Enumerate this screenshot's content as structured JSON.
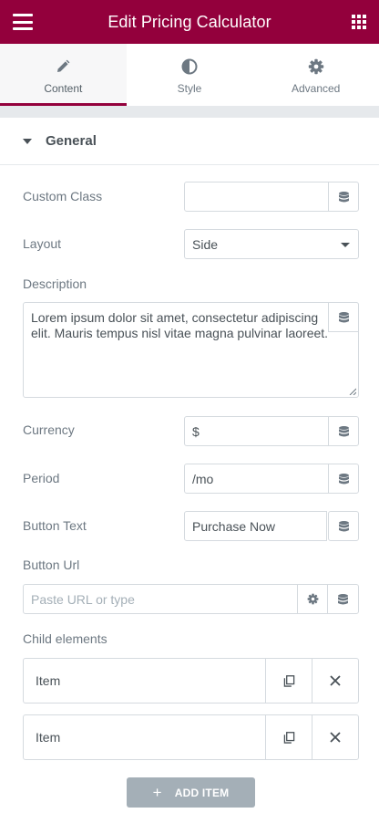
{
  "header": {
    "title": "Edit Pricing Calculator"
  },
  "tabs": [
    {
      "label": "Content",
      "icon": "pencil-icon",
      "active": true
    },
    {
      "label": "Style",
      "icon": "half-circle-icon",
      "active": false
    },
    {
      "label": "Advanced",
      "icon": "gear-icon",
      "active": false
    }
  ],
  "section": {
    "title": "General"
  },
  "fields": {
    "custom_class": {
      "label": "Custom Class",
      "value": ""
    },
    "layout": {
      "label": "Layout",
      "value": "Side"
    },
    "description": {
      "label": "Description",
      "line1": "Lorem ipsum dolor sit amet, consectetur adipiscing",
      "line2": "elit. Mauris tempus nisl vitae magna pulvinar laoreet."
    },
    "currency": {
      "label": "Currency",
      "value": "$"
    },
    "period": {
      "label": "Period",
      "value": "/mo"
    },
    "button_text": {
      "label": "Button Text",
      "value": "Purchase Now"
    },
    "button_url": {
      "label": "Button Url",
      "placeholder": "Paste URL or type"
    }
  },
  "child_elements": {
    "label": "Child elements",
    "items": [
      {
        "label": "Item"
      },
      {
        "label": "Item"
      }
    ],
    "add_label": "ADD ITEM"
  },
  "colors": {
    "accent": "#93003c",
    "border": "#d5dadf",
    "text": "#6d7882",
    "add_button": "#a4afb7"
  }
}
